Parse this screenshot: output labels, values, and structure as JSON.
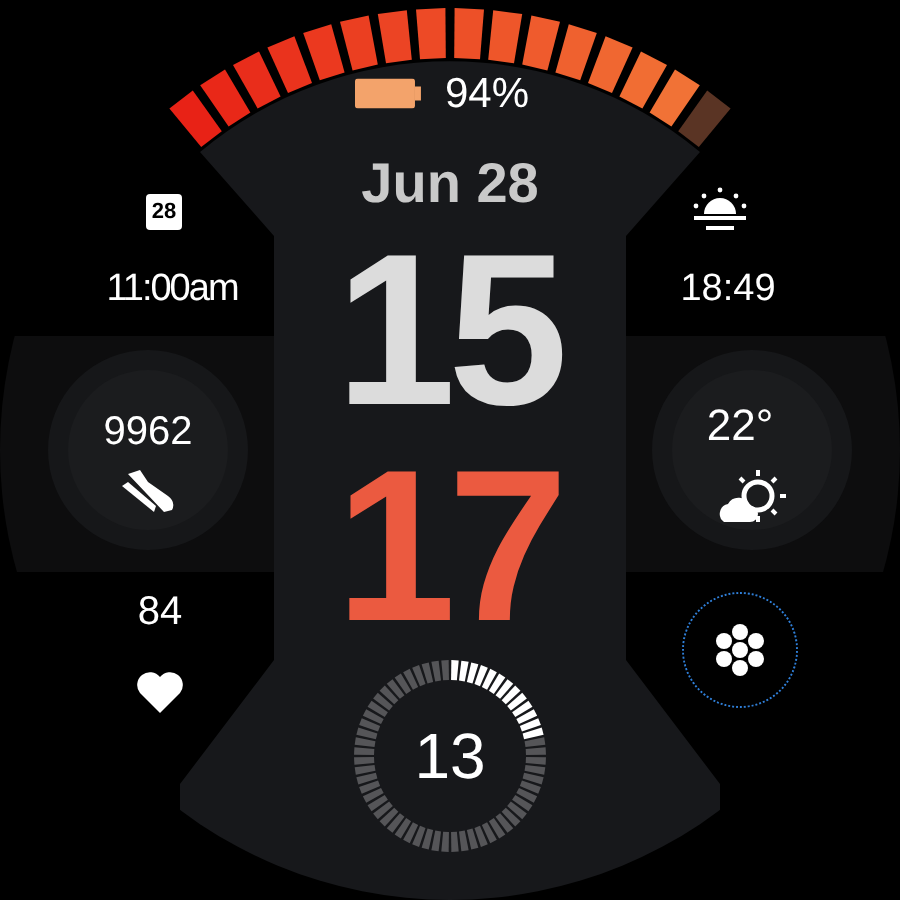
{
  "battery": {
    "level": 0.94,
    "reading": "94%"
  },
  "date": "Jun 28",
  "time": {
    "hour": "15",
    "minute": "17"
  },
  "seconds": {
    "text": "13"
  },
  "left": {
    "calendar_day": "28",
    "alarm": "11:00am",
    "steps": "9962",
    "heart_rate": "84"
  },
  "right": {
    "sunset": "18:49",
    "temperature": "22°"
  }
}
